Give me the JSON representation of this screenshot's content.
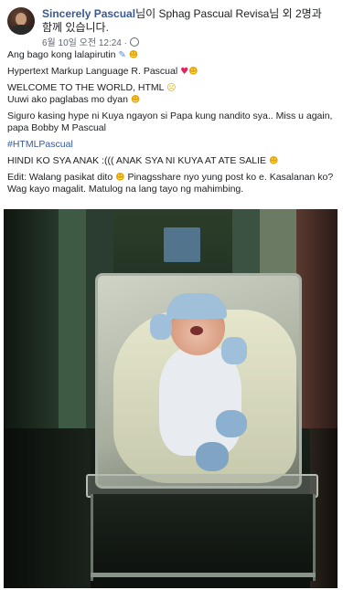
{
  "post": {
    "author": "Sincerely Pascual",
    "with_prefix": "님이 ",
    "tagged": "Sphag Pascual Revisa",
    "tag_suffix": "님 외 2명과 함께 있습니다.",
    "timestamp": "6월 10일 오전 12:24 · ",
    "lines": [
      "Ang bago kong lalapirutin",
      "Hypertext Markup Language R. Pascual",
      "WELCOME TO THE WORLD, HTML",
      "Uuwi ako paglabas mo dyan",
      "Siguro kasing hype ni Kuya ngayon si Papa kung nandito sya.. Miss u again, papa Bobby M Pascual",
      "#HTMLPascual",
      "HINDI KO SYA ANAK :((( ANAK SYA NI KUYA AT ATE SALIE",
      "Edit: Walang pasikat dito",
      " Pinagsshare nyo yung post ko e. Kasalanan ko? Wag kayo magalit. Matulog na lang tayo ng mahimbing."
    ]
  },
  "emojis": {
    "pen": "✎",
    "smile": "☻",
    "heart": "♥",
    "cry": "☹",
    "laugh": "☻"
  },
  "colors": {
    "link": "#385898",
    "text": "#1c1e21",
    "meta": "#616770"
  }
}
